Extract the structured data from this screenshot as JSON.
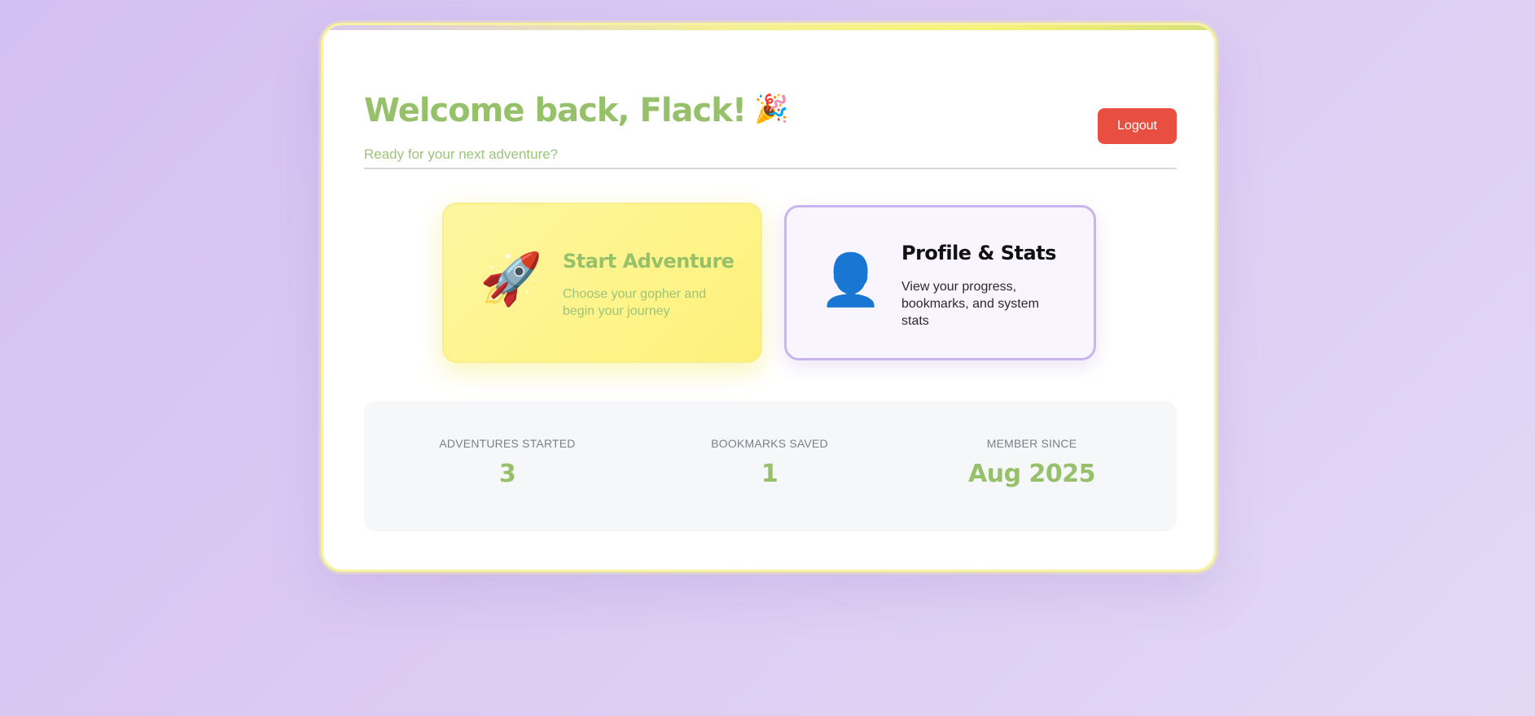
{
  "header": {
    "welcome_title": "Welcome back, Flack!",
    "welcome_icon": "party-popper-icon",
    "welcome_emoji": "🎉",
    "subtitle": "Ready for your next adventure?",
    "logout_label": "Logout"
  },
  "tiles": [
    {
      "icon": "rocket-icon",
      "emoji": "🚀",
      "title": "Start Adventure",
      "description": "Choose your gopher and begin your journey"
    },
    {
      "icon": "user-silhouette-icon",
      "emoji": "👤",
      "title": "Profile & Stats",
      "description": "View your progress, bookmarks, and system stats"
    }
  ],
  "stats": [
    {
      "label": "ADVENTURES STARTED",
      "value": "3"
    },
    {
      "label": "BOOKMARKS SAVED",
      "value": "1"
    },
    {
      "label": "MEMBER SINCE",
      "value": "Aug 2025"
    }
  ],
  "colors": {
    "accent_green": "#96c06a",
    "logout_red": "#e84f40",
    "start_tile_yellow": "#fdf59f",
    "profile_tile_border": "#c8b5ef",
    "background_lavender": "#d9c8f2"
  }
}
